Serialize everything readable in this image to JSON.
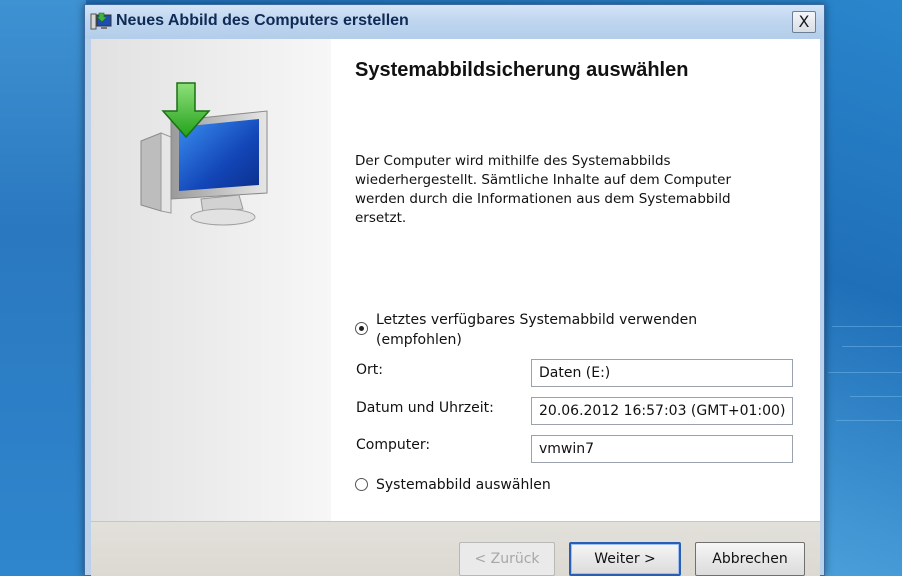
{
  "window": {
    "title": "Neues Abbild des Computers erstellen",
    "close_label": "X"
  },
  "page": {
    "heading": "Systemabbildsicherung auswählen",
    "description": "Der Computer wird mithilfe des Systemabbilds wiederhergestellt. Sämtliche Inhalte auf dem Computer werden durch die Informationen aus dem Systemabbild ersetzt."
  },
  "options": {
    "latest": {
      "label_line1": "Letztes verfügbares Systemabbild verwenden",
      "label_line2": "(empfohlen)",
      "selected": true
    },
    "select": {
      "label": "Systemabbild auswählen",
      "selected": false
    }
  },
  "fields": {
    "location": {
      "label": "Ort:",
      "value": "Daten (E:)"
    },
    "datetime": {
      "label": "Datum und Uhrzeit:",
      "value": "20.06.2012 16:57:03 (GMT+01:00)"
    },
    "computer": {
      "label": "Computer:",
      "value": "vmwin7"
    }
  },
  "buttons": {
    "back": "< Zurück",
    "next": "Weiter >",
    "cancel": "Abbrechen"
  },
  "icons": {
    "window_icon": "computer-restore-icon",
    "illustration": "monitor-with-green-arrow-icon"
  }
}
